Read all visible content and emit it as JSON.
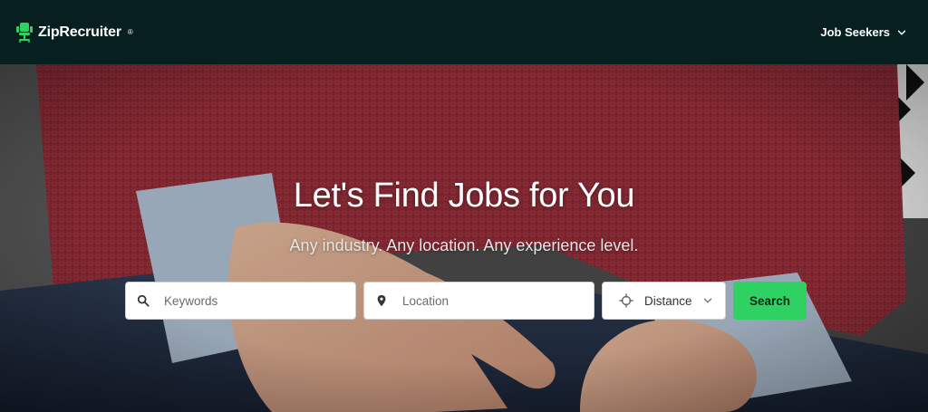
{
  "header": {
    "brand_name": "ZipRecruiter",
    "brand_mark": "®",
    "nav_label": "Job Seekers",
    "colors": {
      "background": "#071f1f",
      "brand_accent": "#2fd262",
      "text": "#ffffff"
    }
  },
  "hero": {
    "title": "Let's Find Jobs for You",
    "subtitle": "Any industry. Any location. Any experience level.",
    "background_description_icon": "person-red-sweater-photo"
  },
  "search": {
    "keywords_placeholder": "Keywords",
    "location_placeholder": "Location",
    "distance_label": "Distance",
    "button_label": "Search",
    "button_color": "#2fd262"
  }
}
